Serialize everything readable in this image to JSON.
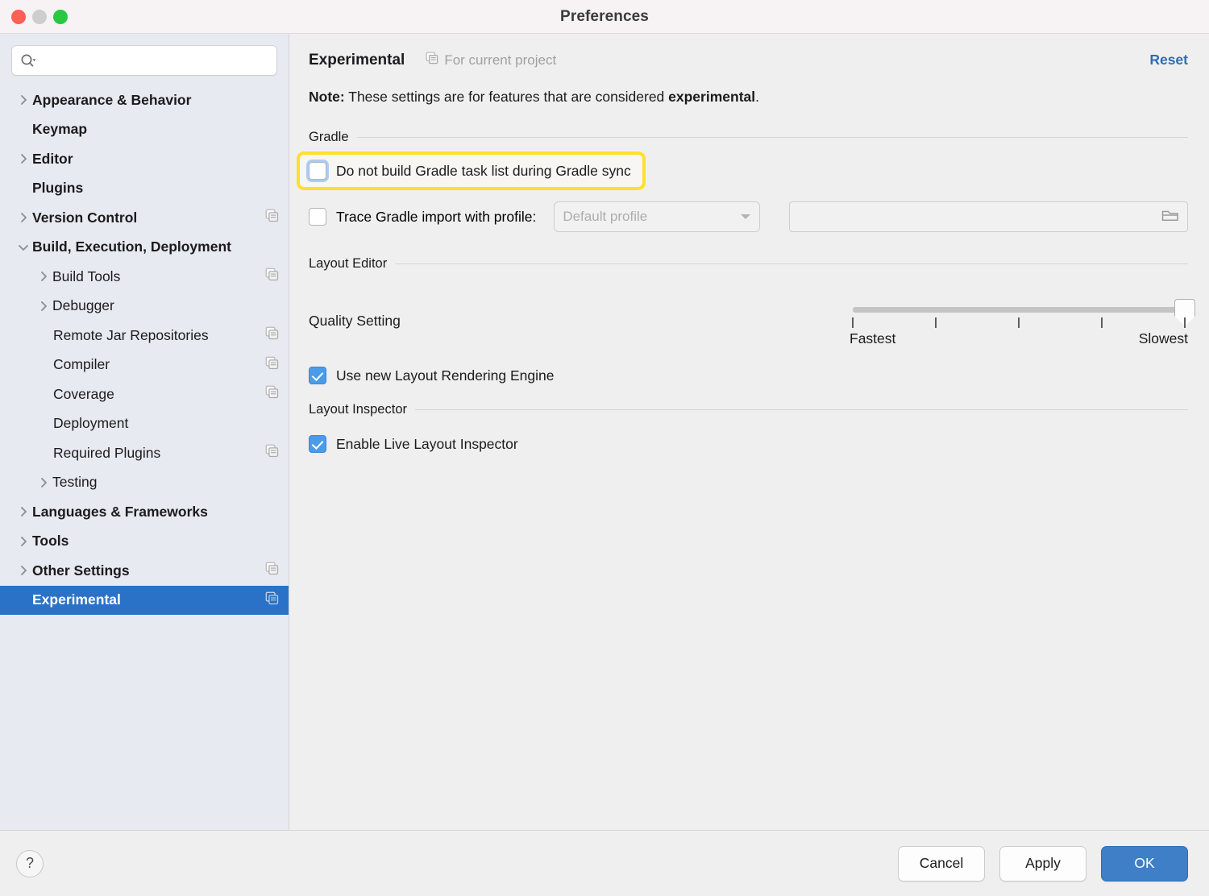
{
  "window": {
    "title": "Preferences",
    "traffic_lights": [
      "close-button",
      "minimize-button",
      "zoom-button"
    ]
  },
  "sidebar": {
    "search": {
      "value": "",
      "placeholder": "",
      "icon": "search-icon"
    },
    "items": [
      {
        "label": "Appearance & Behavior",
        "level": 0,
        "bold": true,
        "chevron": "right",
        "copy": false
      },
      {
        "label": "Keymap",
        "level": 0,
        "bold": true,
        "chevron": "none",
        "copy": false
      },
      {
        "label": "Editor",
        "level": 0,
        "bold": true,
        "chevron": "right",
        "copy": false
      },
      {
        "label": "Plugins",
        "level": 0,
        "bold": true,
        "chevron": "none",
        "copy": false
      },
      {
        "label": "Version Control",
        "level": 0,
        "bold": true,
        "chevron": "right",
        "copy": true
      },
      {
        "label": "Build, Execution, Deployment",
        "level": 0,
        "bold": true,
        "chevron": "down",
        "copy": false
      },
      {
        "label": "Build Tools",
        "level": 1,
        "bold": false,
        "chevron": "right",
        "copy": true
      },
      {
        "label": "Debugger",
        "level": 1,
        "bold": false,
        "chevron": "right",
        "copy": false
      },
      {
        "label": "Remote Jar Repositories",
        "level": 1,
        "bold": false,
        "chevron": "none",
        "copy": true
      },
      {
        "label": "Compiler",
        "level": 1,
        "bold": false,
        "chevron": "none",
        "copy": true
      },
      {
        "label": "Coverage",
        "level": 1,
        "bold": false,
        "chevron": "none",
        "copy": true
      },
      {
        "label": "Deployment",
        "level": 1,
        "bold": false,
        "chevron": "none",
        "copy": false
      },
      {
        "label": "Required Plugins",
        "level": 1,
        "bold": false,
        "chevron": "none",
        "copy": true
      },
      {
        "label": "Testing",
        "level": 1,
        "bold": false,
        "chevron": "right",
        "copy": false
      },
      {
        "label": "Languages & Frameworks",
        "level": 0,
        "bold": true,
        "chevron": "right",
        "copy": false
      },
      {
        "label": "Tools",
        "level": 0,
        "bold": true,
        "chevron": "right",
        "copy": false
      },
      {
        "label": "Other Settings",
        "level": 0,
        "bold": true,
        "chevron": "right",
        "copy": true
      },
      {
        "label": "Experimental",
        "level": 0,
        "bold": true,
        "chevron": "none",
        "copy": true,
        "selected": true
      }
    ]
  },
  "main": {
    "page_title": "Experimental",
    "for_current_project": "For current project",
    "for_current_project_icon": "copy-icon",
    "reset_label": "Reset",
    "note_prefix": "Note:",
    "note_body": " These settings are for features that are considered ",
    "note_emphasis": "experimental",
    "note_suffix": ".",
    "gradle": {
      "group_label": "Gradle",
      "do_not_build": {
        "label": "Do not build Gradle task list during Gradle sync",
        "checked": false,
        "highlighted": true
      },
      "trace": {
        "label": "Trace Gradle import with profile:",
        "checked": false,
        "profile_selected": "Default profile",
        "profile_options": [
          "Default profile"
        ],
        "path_value": "",
        "browse_icon": "folder-icon"
      }
    },
    "layout_editor": {
      "group_label": "Layout Editor",
      "quality_label": "Quality Setting",
      "slider_min_label": "Fastest",
      "slider_max_label": "Slowest",
      "slider_ticks": 5,
      "slider_value": 5,
      "use_new_engine": {
        "label": "Use new Layout Rendering Engine",
        "checked": true
      }
    },
    "layout_inspector": {
      "group_label": "Layout Inspector",
      "enable_live": {
        "label": "Enable Live Layout Inspector",
        "checked": true
      }
    }
  },
  "footer": {
    "help_label": "?",
    "cancel_label": "Cancel",
    "apply_label": "Apply",
    "ok_label": "OK"
  },
  "colors": {
    "accent_blue": "#2a72c8",
    "link_blue": "#2f6cb5",
    "primary_button": "#3e7fc8",
    "highlight_yellow": "#ffe02b",
    "checkbox_checked": "#4a9bea",
    "sidebar_bg": "#e7eaf0",
    "panel_bg": "#f0efef",
    "titlebar_bg": "#f7f2f3"
  }
}
